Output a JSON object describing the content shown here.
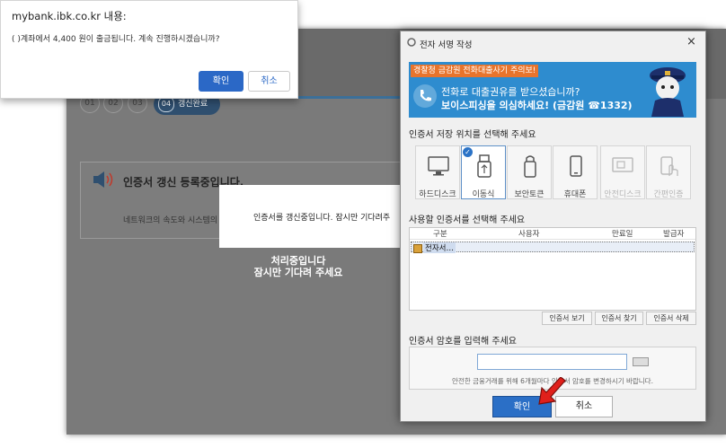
{
  "alert": {
    "origin": "mybank.ibk.co.kr 내용:",
    "message": "( )계좌에서 4,400 원이 출금됩니다. 계속 진행하시겠습니까?",
    "ok": "확인",
    "cancel": "취소"
  },
  "background": {
    "steps": [
      "01",
      "02",
      "03"
    ],
    "active_step_num": "04",
    "active_step_label": "갱신완료",
    "renew_title": "인증서 갱신 등록중입니다.",
    "renew_sub": "네트워크의 속도와 시스템의",
    "renew_message": "인증서를 갱신중입니다. 잠시만 기다려주",
    "processing_line1": "처리중입니다",
    "processing_line2": "잠시만 기다려 주세요"
  },
  "sign_dialog": {
    "title": "전자 서명 작성",
    "close": "×",
    "banner": {
      "tag": "경찰청 금감원 전화대출사기 주의보!",
      "line1": "전화로 대출권유를 받으셨습니까?",
      "line2": "보이스피싱을 의심하세요! (금감원 ☎1332)"
    },
    "location_title": "인증서 저장 위치를 선택해 주세요",
    "locations": [
      {
        "label": "하드디스크",
        "icon": "monitor-icon"
      },
      {
        "label": "이동식",
        "icon": "usb-icon"
      },
      {
        "label": "보안토큰",
        "icon": "token-icon"
      },
      {
        "label": "휴대폰",
        "icon": "phone-icon"
      },
      {
        "label": "안전디스크",
        "icon": "safe-disk-icon"
      },
      {
        "label": "간편인증",
        "icon": "hand-icon"
      }
    ],
    "cert_title": "사용할 인증서를 선택해 주세요",
    "cert_columns": [
      "구분",
      "사용자",
      "만료일",
      "발급자"
    ],
    "cert_row_name": "전자서…",
    "cert_buttons": [
      "인증서 보기",
      "인증서 찾기",
      "인증서 삭제"
    ],
    "pw_title": "인증서 암호를 입력해 주세요",
    "pw_note": "안전한 금융거래를 위해 6개월마다 인증서 암호를 변경하시기 바랍니다.",
    "ok": "확인",
    "cancel": "취소"
  },
  "colors": {
    "primary_button": "#2b6fc6",
    "banner_blue": "#2e8ccf",
    "banner_tag": "#e8742c",
    "arrow_red": "#e0201b"
  }
}
